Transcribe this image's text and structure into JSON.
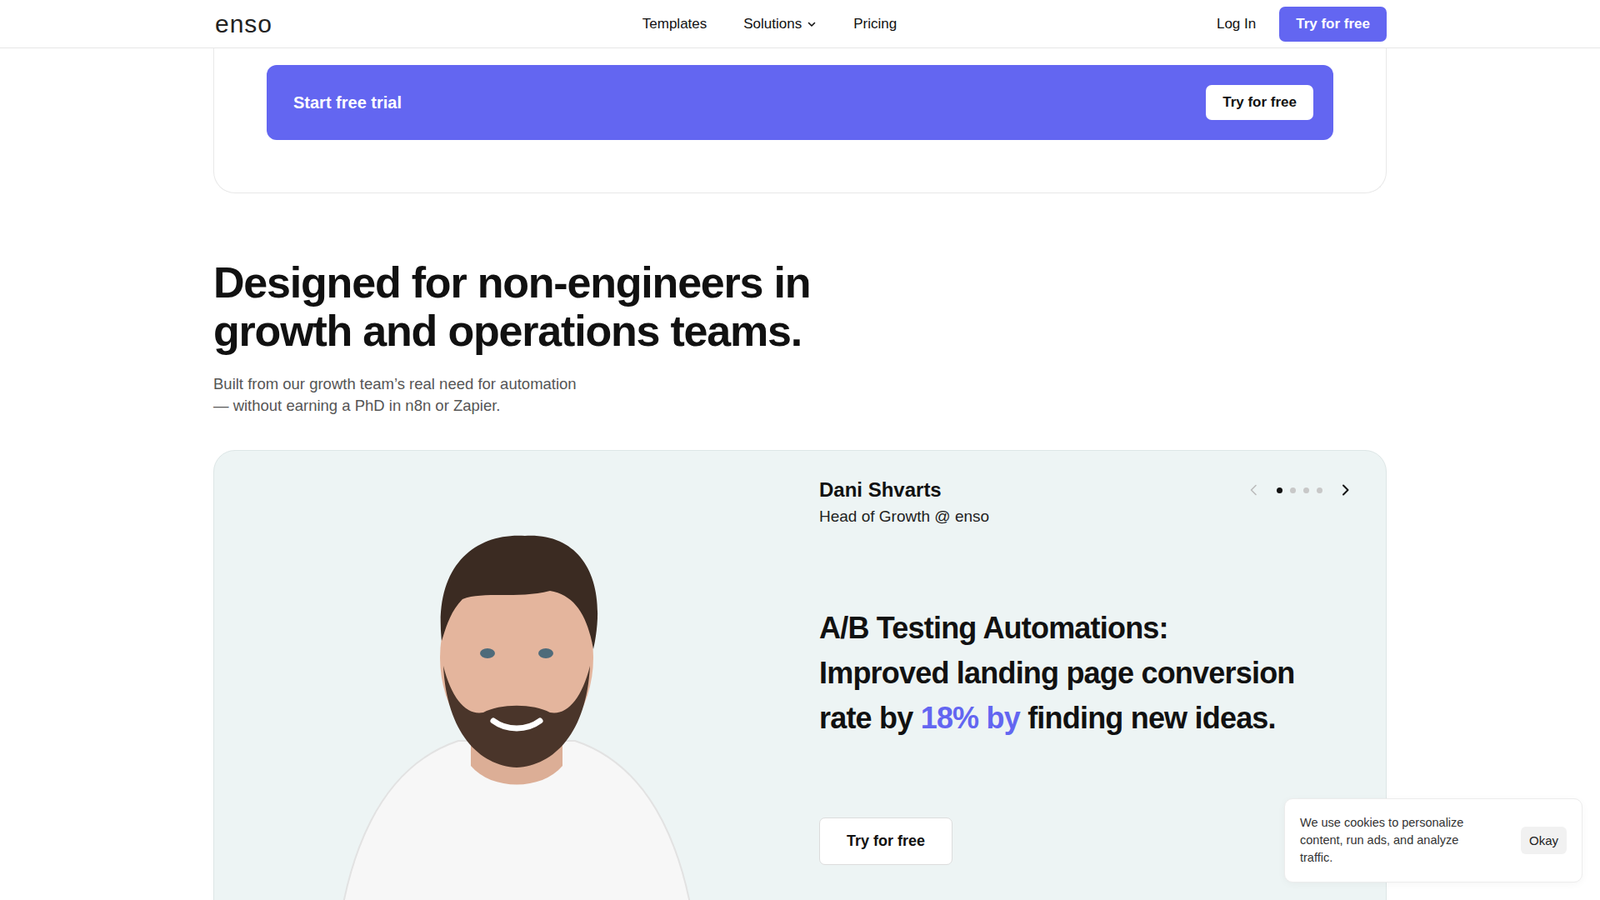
{
  "nav": {
    "logo": "enso",
    "links": [
      {
        "label": "Templates",
        "has_dropdown": false
      },
      {
        "label": "Solutions",
        "has_dropdown": true
      },
      {
        "label": "Pricing",
        "has_dropdown": false
      }
    ],
    "login": "Log In",
    "cta": "Try for free"
  },
  "trial_banner": {
    "title": "Start free trial",
    "button": "Try for free"
  },
  "section": {
    "heading_lines": [
      "Designed for non-engineers in",
      "growth and operations teams."
    ],
    "subtitle_lines": [
      "Built from our growth team’s real need for automation",
      "— without earning a PhD in n8n or Zapier."
    ]
  },
  "testimonial": {
    "name": "Dani Shvarts",
    "role": "Head of Growth @ enso",
    "prev_disabled": true,
    "slides": [
      {
        "selected": true
      },
      {
        "selected": false
      },
      {
        "selected": false
      },
      {
        "selected": false
      }
    ],
    "quote_title": "A/B Testing Automations:",
    "quote_parts": [
      {
        "text": "Improved landing page conversion rate by ",
        "highlight": false
      },
      {
        "text": "18% by",
        "highlight": true
      },
      {
        "text": " finding new ideas.",
        "highlight": false
      }
    ],
    "button": "Try for free"
  },
  "cookie": {
    "text": "We use cookies to personalize content, run ads, and analyze traffic.",
    "button": "Okay"
  }
}
